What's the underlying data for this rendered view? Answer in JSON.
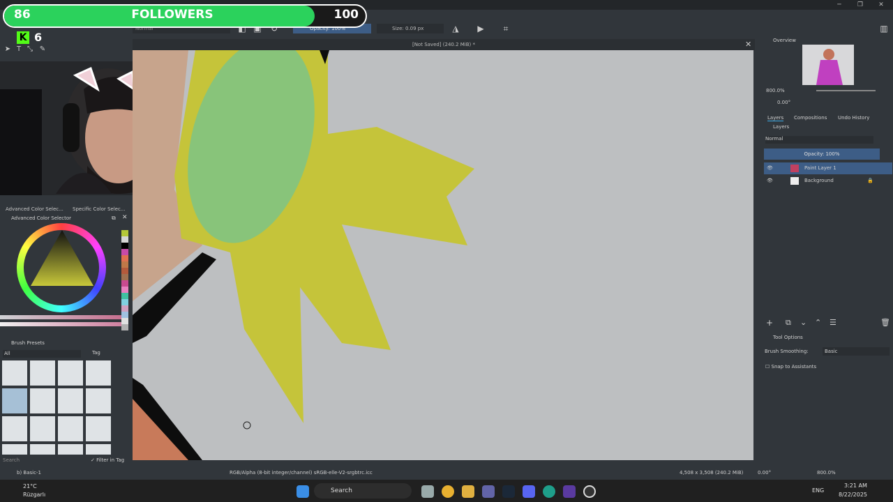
{
  "overlay": {
    "followers_current": "86",
    "followers_label": "FOLLOWERS",
    "followers_goal": "100",
    "followers_progress": 0.86,
    "kick_count": "6"
  },
  "toolbar": {
    "blend_mode": "Normal",
    "opacity_label": "Opacity: 100%",
    "size_label": "Size: 0.09 px"
  },
  "canvas": {
    "document_title": "[Not Saved]  (240.2 MiB) *"
  },
  "left_dock": {
    "tabs": [
      "Advanced Color Selec...",
      "Specific Color Selec..."
    ],
    "color_selector_title": "Advanced Color Selector",
    "color_history": [
      "#b5c83a",
      "#d6d6d6",
      "#000000",
      "#c84aa8",
      "#e07050",
      "#c07848",
      "#b45a3c",
      "#a07050",
      "#c84a90",
      "#e880c0",
      "#40c0a0",
      "#80d0e0",
      "#d0a0c0",
      "#a0c0e0",
      "#e0e0e0",
      "#b0b0b0"
    ],
    "brush_presets_title": "Brush Presets",
    "brush_filter": "All",
    "brush_tag": "Tag",
    "search_placeholder": "Search",
    "filter_in_tag": "Filter in Tag"
  },
  "right_dock": {
    "overview_title": "Overview",
    "zoom": "800.0%",
    "rotation": "0.00°",
    "tabs": [
      "Layers",
      "Compositions",
      "Undo History"
    ],
    "layers_title": "Layers",
    "layer_blend": "Normal",
    "layer_opacity": "Opacity:  100%",
    "layers": [
      {
        "name": "Paint Layer 1",
        "selected": true
      },
      {
        "name": "Background",
        "selected": false
      }
    ],
    "tool_options_title": "Tool Options",
    "brush_smoothing_label": "Brush Smoothing:",
    "brush_smoothing_value": "Basic",
    "snap_label": "Snap to Assistants"
  },
  "status": {
    "brush": "b) Basic-1",
    "color_profile": "RGB/Alpha (8-bit integer/channel)  sRGB-elle-V2-srgbtrc.icc",
    "dimensions": "4,508 x 3,508 (240.2 MiB)",
    "rotation": "0.00°",
    "zoom": "800.0%"
  },
  "taskbar": {
    "weather_temp": "21°C",
    "weather_desc": "Rüzgarlı",
    "search_label": "Search",
    "language": "ENG",
    "time": "3:21 AM",
    "date": "8/22/2025"
  }
}
